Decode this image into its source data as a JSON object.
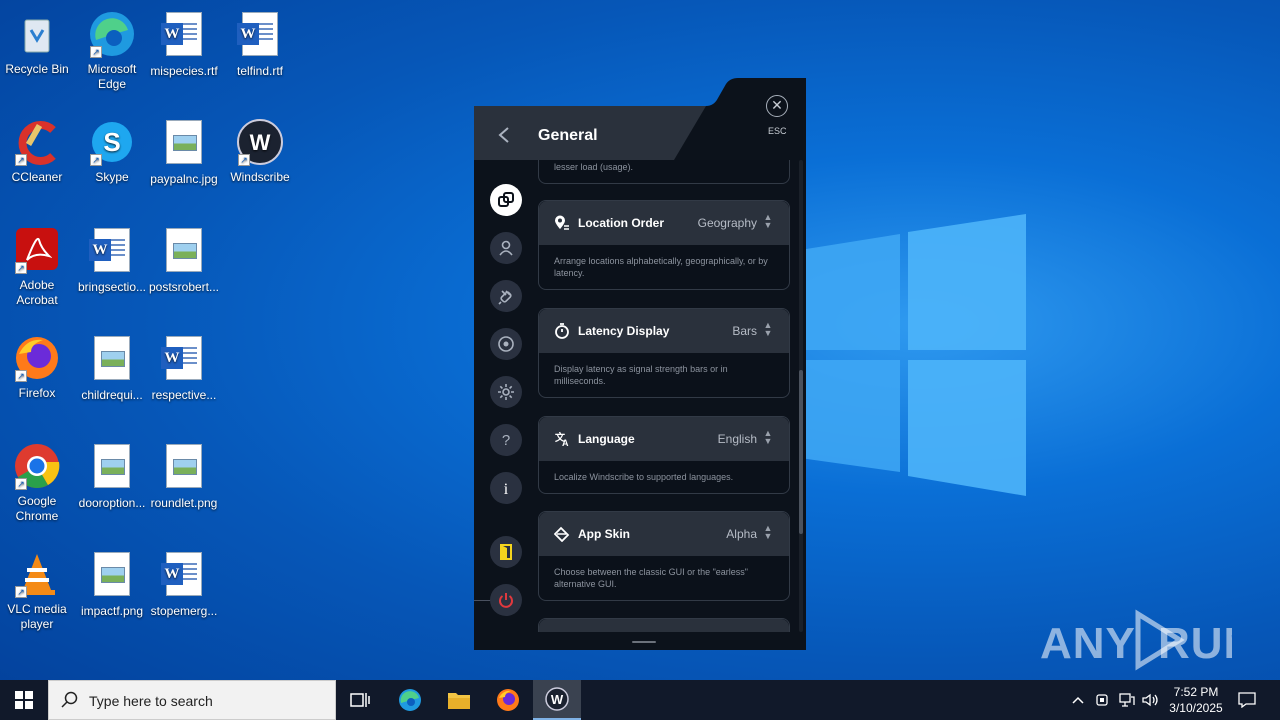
{
  "desktop": {
    "icons": [
      {
        "label": "Recycle Bin"
      },
      {
        "label": "Microsoft Edge"
      },
      {
        "label": "mispecies.rtf"
      },
      {
        "label": "telfind.rtf"
      },
      {
        "label": "CCleaner"
      },
      {
        "label": "Skype"
      },
      {
        "label": "paypalnc.jpg"
      },
      {
        "label": "Windscribe"
      },
      {
        "label": "Adobe Acrobat"
      },
      {
        "label": "bringsectio..."
      },
      {
        "label": "postsrobert..."
      },
      {
        "label": "Firefox"
      },
      {
        "label": "childrequi..."
      },
      {
        "label": "respective..."
      },
      {
        "label": "Google Chrome"
      },
      {
        "label": "dooroption..."
      },
      {
        "label": "roundlet.png"
      },
      {
        "label": "VLC media player"
      },
      {
        "label": "impactf.png"
      },
      {
        "label": "stopemerg..."
      }
    ]
  },
  "app": {
    "title": "General",
    "esc_label": "ESC",
    "top_fragment": "lesser load (usage).",
    "settings": [
      {
        "icon": "location-pin-icon",
        "title": "Location Order",
        "value": "Geography",
        "desc": "Arrange locations alphabetically, geographically, or by latency."
      },
      {
        "icon": "stopwatch-icon",
        "title": "Latency Display",
        "value": "Bars",
        "desc": "Display latency as signal strength bars or in milliseconds."
      },
      {
        "icon": "translate-icon",
        "title": "Language",
        "value": "English",
        "desc": "Localize Windscribe to supported languages."
      },
      {
        "icon": "paint-bucket-icon",
        "title": "App Skin",
        "value": "Alpha",
        "desc": "Choose between the classic GUI or the \"earless\" alternative GUI."
      }
    ],
    "colors": {
      "panel": "#0b111a",
      "header": "#2a313c",
      "accent_yellow": "#f5d51e",
      "power_red": "#e0393e"
    }
  },
  "taskbar": {
    "search_placeholder": "Type here to search",
    "time": "7:52 PM",
    "date": "3/10/2025"
  },
  "watermark": "ANY RUN"
}
